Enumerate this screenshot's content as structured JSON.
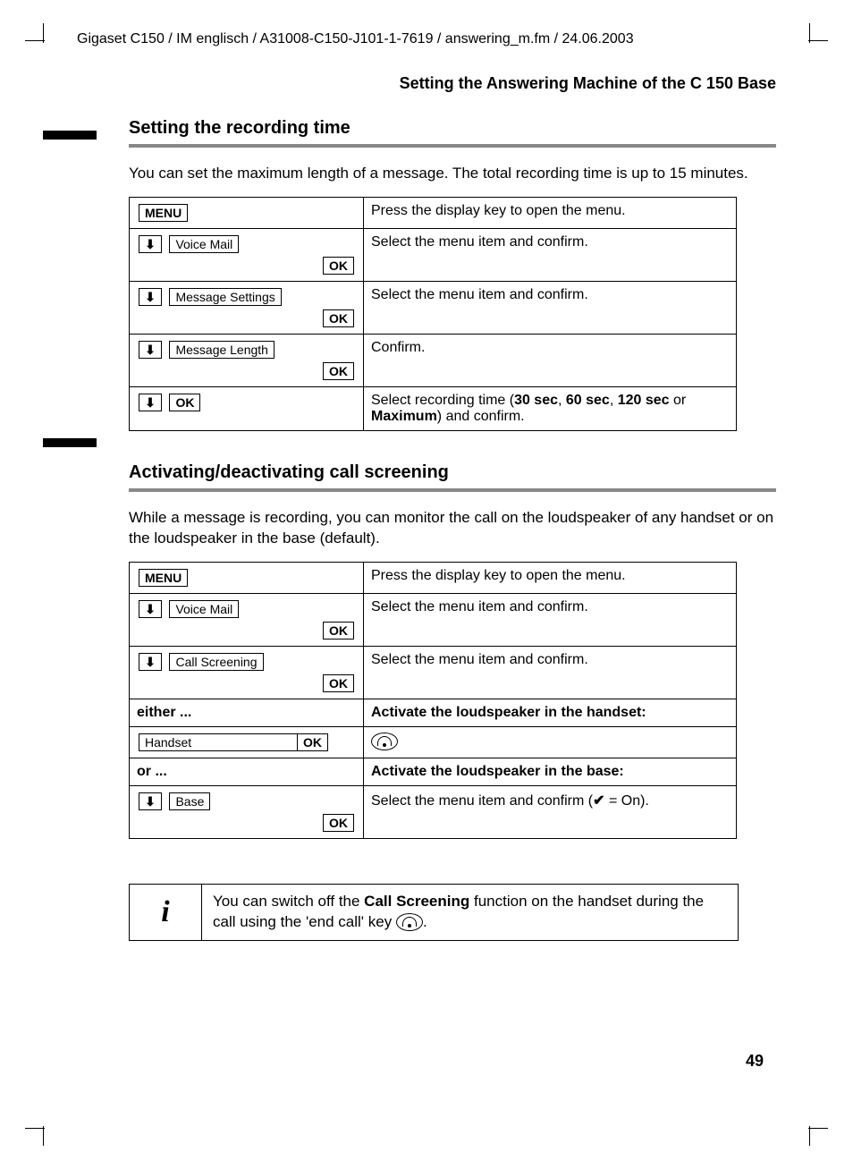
{
  "docPath": "Gigaset C150 / IM englisch / A31008-C150-J101-1-7619 / answering_m.fm / 24.06.2003",
  "chapterTitle": "Setting the Answering Machine of the C 150 Base",
  "section1": {
    "title": "Setting the recording time",
    "intro": "You can set the maximum length of a message. The total recording time is up to 15 minutes.",
    "rows": {
      "r0": {
        "key": "MENU",
        "desc": "Press the display key to open the menu."
      },
      "r1": {
        "arrow": "⬇",
        "item": "Voice Mail",
        "ok": "OK",
        "desc": "Select the menu item and confirm."
      },
      "r2": {
        "arrow": "⬇",
        "item": "Message Settings",
        "ok": "OK",
        "desc": "Select the menu item and confirm."
      },
      "r3": {
        "arrow": "⬇",
        "item": "Message Length",
        "ok": "OK",
        "desc": "Confirm."
      },
      "r4": {
        "arrow": "⬇",
        "ok": "OK",
        "desc_pre": "Select recording time (",
        "b1": "30 sec",
        "sep1": ", ",
        "b2": "60 sec",
        "sep2": ", ",
        "b3": "120 sec",
        "sep3": " or ",
        "b4": "Maximum",
        "desc_post": ") and confirm."
      }
    }
  },
  "section2": {
    "title": "Activating/deactivating call screening",
    "intro": "While a message is recording, you can monitor the call on the loudspeaker of any handset or on the loudspeaker in the base (default).",
    "rows": {
      "r0": {
        "key": "MENU",
        "desc": "Press the display key to open the menu."
      },
      "r1": {
        "arrow": "⬇",
        "item": "Voice Mail",
        "ok": "OK",
        "desc": "Select the menu item and confirm."
      },
      "r2": {
        "arrow": "⬇",
        "item": "Call Screening",
        "ok": "OK",
        "desc": "Select the menu item and confirm."
      },
      "either": {
        "label": "either ...",
        "desc": "Activate the loudspeaker in the handset:"
      },
      "r3": {
        "item": "Handset",
        "ok": "OK",
        "iconName": "speaker-icon"
      },
      "or": {
        "label": "or ...",
        "desc": "Activate the loudspeaker in the base:"
      },
      "r4": {
        "arrow": "⬇",
        "item": "Base",
        "ok": "OK",
        "desc_pre": "Select the menu item and confirm (",
        "check": "✔",
        "eq": " = On).",
        "desc_full": "Select the menu item and confirm (✔ = On)."
      }
    }
  },
  "infoBox": {
    "icon": "i",
    "text_pre": "You can switch off the ",
    "bold": "Call Screening",
    "text_mid": " function on the handset during the call using the 'end call' key ",
    "text_post": "."
  },
  "pageNumber": "49"
}
